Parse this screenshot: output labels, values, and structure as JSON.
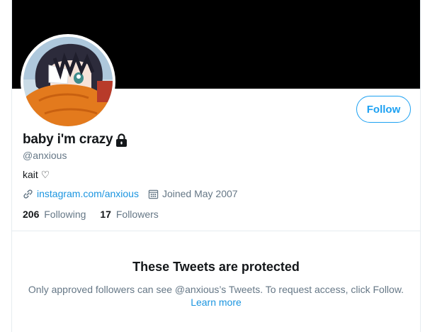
{
  "profile": {
    "display_name": "baby i'm crazy",
    "handle": "@anxious",
    "bio": "kait ♡",
    "website": "instagram.com/anxious",
    "joined": "Joined May 2007",
    "following_count": "206",
    "following_label": "Following",
    "followers_count": "17",
    "followers_label": "Followers"
  },
  "actions": {
    "follow_label": "Follow"
  },
  "protected": {
    "title": "These Tweets are protected",
    "body_line1": "Only approved followers can see @anxious’s Tweets. To request access, click Follow.",
    "learn_more": "Learn more"
  },
  "icons": {
    "lock": "lock-icon",
    "link": "link-icon",
    "calendar": "calendar-icon"
  },
  "colors": {
    "accent": "#1da1f2",
    "link": "#1b95e0",
    "secondary_text": "#657786",
    "banner": "#000000"
  }
}
